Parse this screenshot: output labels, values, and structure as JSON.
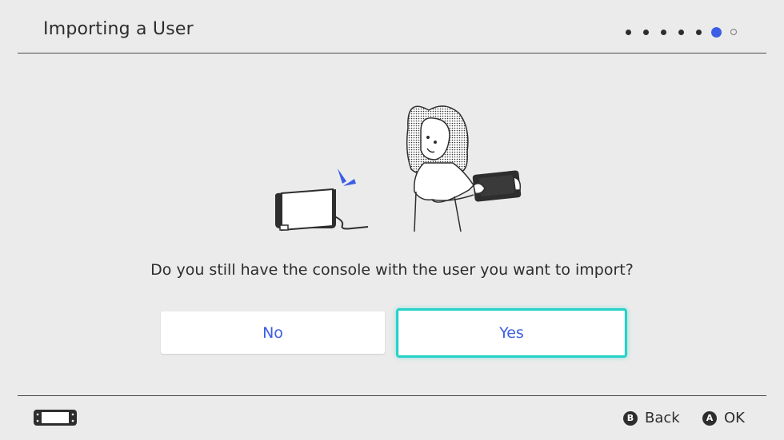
{
  "header": {
    "title": "Importing a User",
    "progress": {
      "total_steps": 7,
      "current_step": 6
    }
  },
  "main": {
    "question": "Do you still have the console with the user you want to import?",
    "buttons": {
      "no_label": "No",
      "yes_label": "Yes",
      "focused": "Yes"
    }
  },
  "footer": {
    "back_key": "B",
    "back_label": "Back",
    "ok_key": "A",
    "ok_label": "OK"
  },
  "colors": {
    "accent": "#3c5ee6",
    "focus": "#27d2c8",
    "background": "#ebebeb"
  }
}
